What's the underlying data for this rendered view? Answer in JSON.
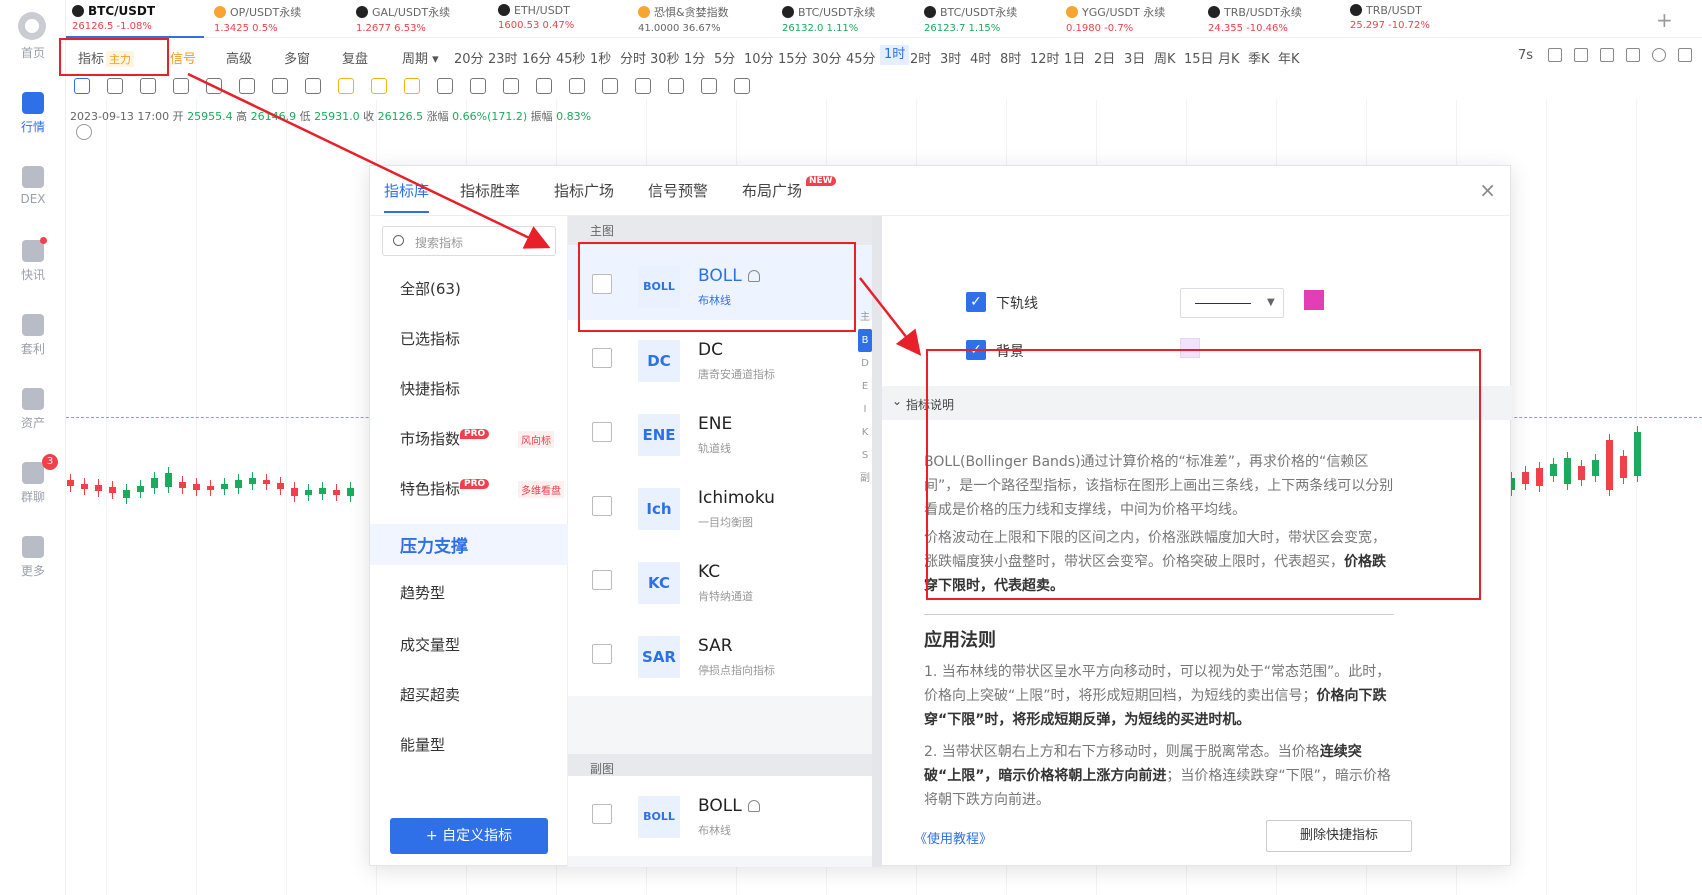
{
  "sidebar": {
    "items": [
      {
        "label": "首页",
        "icon": "home-icon"
      },
      {
        "label": "行情",
        "icon": "market-icon",
        "active": true
      },
      {
        "label": "DEX",
        "icon": "dex-icon"
      },
      {
        "label": "快讯",
        "icon": "news-icon"
      },
      {
        "label": "套利",
        "icon": "arbitrage-icon"
      },
      {
        "label": "资产",
        "icon": "wallet-icon"
      },
      {
        "label": "群聊",
        "icon": "chat-icon",
        "badge": "3"
      },
      {
        "label": "更多",
        "icon": "more-icon"
      }
    ]
  },
  "tickers": [
    {
      "name": "BTC/USDT",
      "value": "26126.5 -1.08%",
      "up": false,
      "active": true
    },
    {
      "name": "OP/USDT永续",
      "value": "1.3425  0.5%",
      "up": false
    },
    {
      "name": "GAL/USDT永续",
      "value": "1.2677  6.53%",
      "up": false
    },
    {
      "name": "ETH/USDT",
      "value": "1600.53  0.47%",
      "up": false
    },
    {
      "name": "恐惧&贪婪指数",
      "value": "41.0000  36.67%",
      "up": null
    },
    {
      "name": "BTC/USDT永续",
      "value": "26132.0  1.11%",
      "up": true
    },
    {
      "name": "BTC/USDT永续",
      "value": "26123.7  1.15%",
      "up": true
    },
    {
      "name": "YGG/USDT 永续",
      "value": "0.1980  -0.7%",
      "up": false
    },
    {
      "name": "TRB/USDT永续",
      "value": "24.355  -10.46%",
      "up": false
    },
    {
      "name": "TRB/USDT",
      "value": "25.297  -10.72%",
      "up": false
    }
  ],
  "toolbar": {
    "indicator": "指标",
    "indicator_tag": "主力",
    "signal": "信号",
    "advanced": "高级",
    "multi": "多窗",
    "replay": "复盘",
    "period": "周期",
    "periods": [
      "20分",
      "23时",
      "16分",
      "45秒",
      "1秒",
      "分时",
      "30秒",
      "1分",
      "5分",
      "10分",
      "15分",
      "30分",
      "45分",
      "1时",
      "2时",
      "3时",
      "4时",
      "8时",
      "12时",
      "1日",
      "2日",
      "3日",
      "周K",
      "15日",
      "月K",
      "季K",
      "年K"
    ],
    "selected_period": "1时",
    "right_label": "7s"
  },
  "ohlc": {
    "date": "2023-09-13 17:00",
    "open_label": "开",
    "open": "25955.4",
    "high_label": "高",
    "high": "26146.9",
    "low_label": "低",
    "low": "25931.0",
    "close_label": "收",
    "close": "26126.5",
    "change_label": "涨幅",
    "change": "0.66%(171.2)",
    "amp_label": "振幅",
    "amp": "0.83%"
  },
  "modal": {
    "tabs": [
      "指标库",
      "指标胜率",
      "指标广场",
      "信号预警",
      "布局广场"
    ],
    "new_badge": "NEW",
    "close": "×",
    "search_placeholder": "搜索指标",
    "categories": [
      {
        "label": "全部(63)"
      },
      {
        "label": "已选指标"
      },
      {
        "label": "快捷指标"
      },
      {
        "label": "市场指数",
        "pro": "PRO",
        "tag": "风向标"
      },
      {
        "label": "特色指标",
        "pro": "PRO",
        "tag": "多维看盘"
      },
      {
        "label": "压力支撑",
        "selected": true
      },
      {
        "label": "趋势型"
      },
      {
        "label": "成交量型"
      },
      {
        "label": "超买超卖"
      },
      {
        "label": "能量型"
      }
    ],
    "custom_button": "+ 自定义指标",
    "main_header": "主图",
    "sub_header": "副图",
    "indicators": [
      {
        "logo": "BOLL",
        "name": "BOLL",
        "desc": "布林线",
        "selected": true,
        "bell": true
      },
      {
        "logo": "DC",
        "name": "DC",
        "desc": "唐奇安通道指标"
      },
      {
        "logo": "ENE",
        "name": "ENE",
        "desc": "轨道线"
      },
      {
        "logo": "Ich",
        "name": "Ichimoku",
        "desc": "一目均衡图"
      },
      {
        "logo": "KC",
        "name": "KC",
        "desc": "肯特纳通道"
      },
      {
        "logo": "SAR",
        "name": "SAR",
        "desc": "停损点指向指标"
      }
    ],
    "sub_indicators": [
      {
        "logo": "BOLL",
        "name": "BOLL",
        "desc": "布林线",
        "bell": true
      }
    ],
    "alphabet": [
      "主",
      "B",
      "D",
      "E",
      "I",
      "K",
      "S",
      "副"
    ],
    "alphabet_selected": "B",
    "settings": {
      "lower_band": "下轨线",
      "lower_band_color": "#e23fb6",
      "background": "背景",
      "background_color": "#f1e3fb"
    },
    "section_title": "指标说明",
    "desc_p1": "BOLL(Bollinger Bands)通过计算价格的“标准差”，再求价格的“信赖区间”，是一个路径型指标，该指标在图形上画出三条线，上下两条线可以分别看成是价格的压力线和支撑线，中间为价格平均线。",
    "desc_p2": "价格波动在上限和下限的区间之内，价格涨跌幅度加大时，带状区会变宽，涨跌幅度狭小盘整时，带状区会变窄。价格突破上限时，代表超买，",
    "desc_p2_bold": "价格跌穿下限时，代表超卖。",
    "rules_title": "应用法则",
    "rule1": "1. 当布林线的带状区呈水平方向移动时，可以视为处于“常态范围”。此时，价格向上突破“上限”时，将形成短期回档，为短线的卖出信号；",
    "rule1_bold": "价格向下跌穿“下限”时，将形成短期反弹，为短线的买进时机。",
    "rule2a": "2. 当带状区朝右上方和右下方移动时，则属于脱离常态。当价格",
    "rule2_bold1": "连续突破“上限”，暗示价格将朝上涨方向前进",
    "rule2b": "；当价格连续跌穿“下限”，暗示价格将朝下跌方向前进。",
    "tutorial": "《使用教程》",
    "delete_button": "删除快捷指标"
  },
  "colors": {
    "accent": "#2f6fe8",
    "up": "#1aab5c",
    "down": "#f0414b",
    "annotation": "#e8202a"
  }
}
